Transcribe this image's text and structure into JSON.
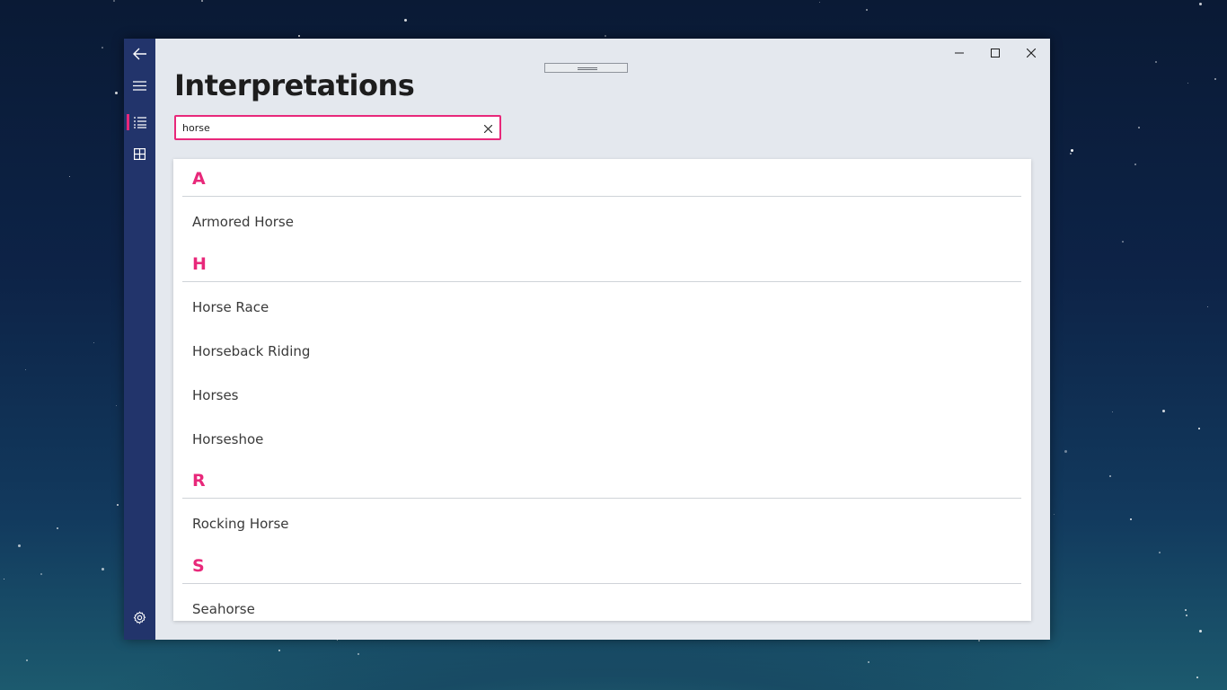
{
  "page": {
    "title": "Interpretations"
  },
  "search": {
    "value": "horse"
  },
  "nav": {
    "items": [
      {
        "icon": "back-arrow-icon"
      },
      {
        "icon": "hamburger-menu-icon"
      },
      {
        "icon": "list-icon",
        "active": true
      },
      {
        "icon": "grid-icon"
      },
      {
        "icon": "gear-icon"
      }
    ]
  },
  "caption_buttons": [
    "minimize-icon",
    "maximize-icon",
    "close-icon"
  ],
  "groups": [
    {
      "letter": "A",
      "items": [
        "Armored Horse"
      ]
    },
    {
      "letter": "H",
      "items": [
        "Horse Race",
        "Horseback Riding",
        "Horses",
        "Horseshoe"
      ]
    },
    {
      "letter": "R",
      "items": [
        "Rocking Horse"
      ]
    },
    {
      "letter": "S",
      "items": [
        "Seahorse"
      ]
    }
  ],
  "colors": {
    "accent": "#e8287a",
    "nav_background": "#22346b",
    "content_background": "#e4e8ee"
  }
}
